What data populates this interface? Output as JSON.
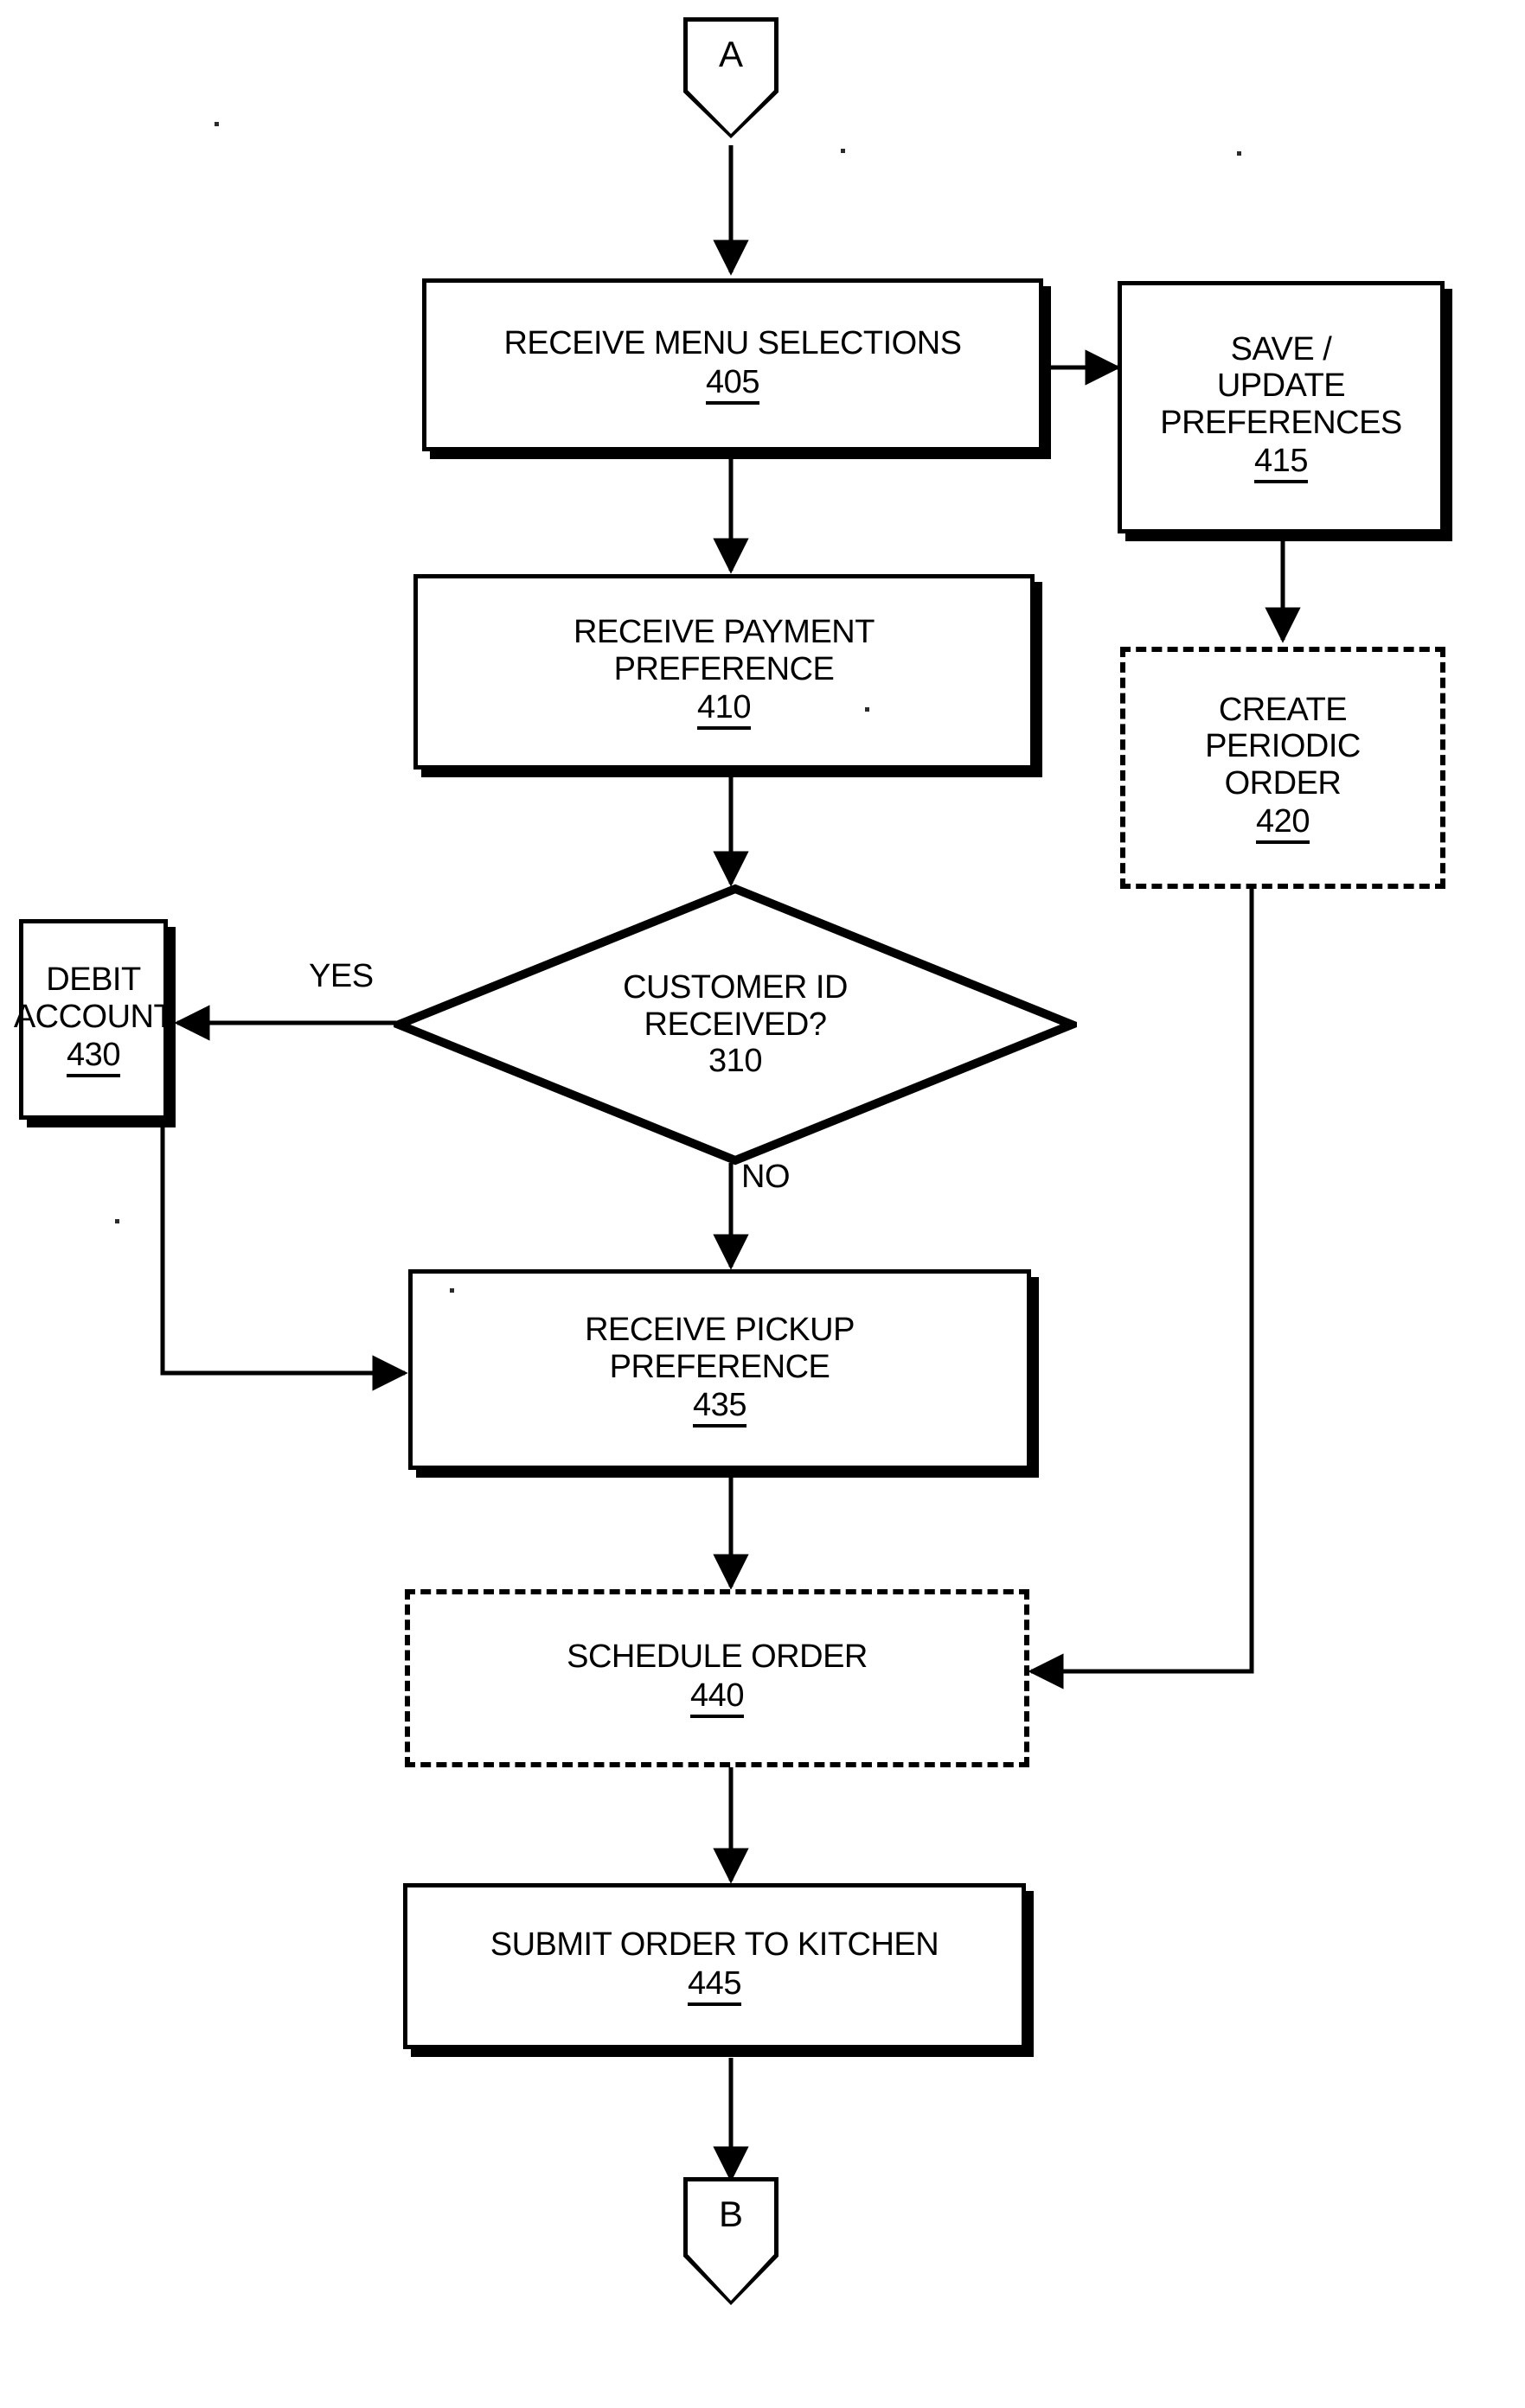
{
  "figure": {
    "type": "flowchart",
    "title": "",
    "orientation": "top-to-bottom"
  },
  "nodes": {
    "connector_a": {
      "label": "A",
      "shape": "connector-pentagon"
    },
    "receive_menu_selections": {
      "line1": "RECEIVE MENU SELECTIONS",
      "ref": "405",
      "shape": "process"
    },
    "save_update_preferences": {
      "line1": "SAVE /",
      "line2": "UPDATE",
      "line3": "PREFERENCES",
      "ref": "415",
      "shape": "process"
    },
    "receive_payment_preference": {
      "line1": "RECEIVE PAYMENT",
      "line2": "PREFERENCE",
      "ref": "410",
      "shape": "process"
    },
    "create_periodic_order": {
      "line1": "CREATE",
      "line2": "PERIODIC",
      "line3": "ORDER",
      "ref": "420",
      "shape": "process-optional-dashed"
    },
    "customer_id_received": {
      "line1": "CUSTOMER ID",
      "line2": "RECEIVED?",
      "ref": "310",
      "shape": "decision"
    },
    "debit_account": {
      "line1": "DEBIT",
      "line2": "ACCOUNT",
      "ref": "430",
      "shape": "process"
    },
    "receive_pickup_preference": {
      "line1": "RECEIVE PICKUP",
      "line2": "PREFERENCE",
      "ref": "435",
      "shape": "process"
    },
    "schedule_order": {
      "line1": "SCHEDULE ORDER",
      "ref": "440",
      "shape": "process-optional-dashed"
    },
    "submit_order_to_kitchen": {
      "line1": "SUBMIT ORDER TO KITCHEN",
      "ref": "445",
      "shape": "process"
    },
    "connector_b": {
      "label": "B",
      "shape": "connector-pentagon"
    }
  },
  "edge_labels": {
    "yes": "YES",
    "no": "NO"
  },
  "edges": [
    {
      "from": "connector_a",
      "to": "receive_menu_selections",
      "label": ""
    },
    {
      "from": "receive_menu_selections",
      "to": "save_update_preferences",
      "label": ""
    },
    {
      "from": "receive_menu_selections",
      "to": "receive_payment_preference",
      "label": ""
    },
    {
      "from": "save_update_preferences",
      "to": "create_periodic_order",
      "label": ""
    },
    {
      "from": "receive_payment_preference",
      "to": "customer_id_received",
      "label": ""
    },
    {
      "from": "customer_id_received",
      "to": "debit_account",
      "label": "YES"
    },
    {
      "from": "customer_id_received",
      "to": "receive_pickup_preference",
      "label": "NO"
    },
    {
      "from": "debit_account",
      "to": "receive_pickup_preference",
      "label": ""
    },
    {
      "from": "receive_pickup_preference",
      "to": "schedule_order",
      "label": ""
    },
    {
      "from": "create_periodic_order",
      "to": "schedule_order",
      "label": ""
    },
    {
      "from": "schedule_order",
      "to": "submit_order_to_kitchen",
      "label": ""
    },
    {
      "from": "submit_order_to_kitchen",
      "to": "connector_b",
      "label": ""
    }
  ],
  "colors": {
    "stroke": "#000000",
    "background": "#ffffff"
  }
}
